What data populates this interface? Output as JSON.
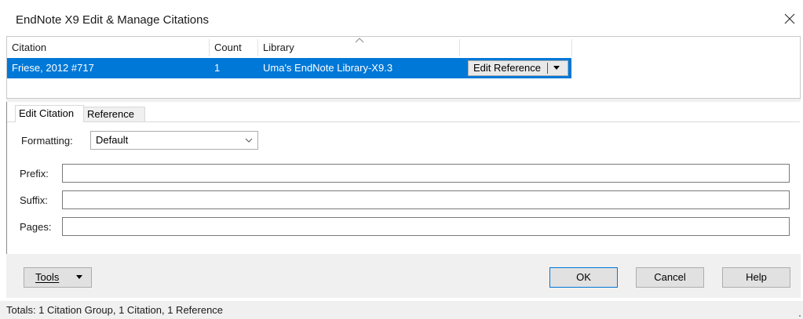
{
  "window": {
    "title": "EndNote X9 Edit & Manage Citations"
  },
  "citations_table": {
    "columns": [
      "Citation",
      "Count",
      "Library"
    ],
    "rows": [
      {
        "citation": "Friese, 2012 #717",
        "count": "1",
        "library": "Uma's EndNote Library-X9.3",
        "action_label": "Edit Reference"
      }
    ],
    "sorted_column": "Library"
  },
  "tabs": [
    {
      "label": "Edit Citation",
      "active": true
    },
    {
      "label": "Reference",
      "active": false
    }
  ],
  "edit_citation": {
    "formatting_label": "Formatting:",
    "formatting_value": "Default",
    "prefix_label": "Prefix:",
    "prefix_value": "",
    "suffix_label": "Suffix:",
    "suffix_value": "",
    "pages_label": "Pages:",
    "pages_value": ""
  },
  "buttons": {
    "tools": "Tools",
    "ok": "OK",
    "cancel": "Cancel",
    "help": "Help"
  },
  "status": {
    "totals": "Totals: 1 Citation Group, 1 Citation, 1 Reference"
  },
  "colors": {
    "selection": "#0078d7",
    "selection_text": "#ffffff",
    "button_face": "#e1e1e1",
    "primary_border": "#0078d7",
    "panel_background": "#f0f0f0"
  },
  "icons": {
    "close": "close-icon",
    "sort": "sort-up-icon",
    "dropdown": "chevron-down-icon",
    "split_caret": "caret-down-icon"
  }
}
